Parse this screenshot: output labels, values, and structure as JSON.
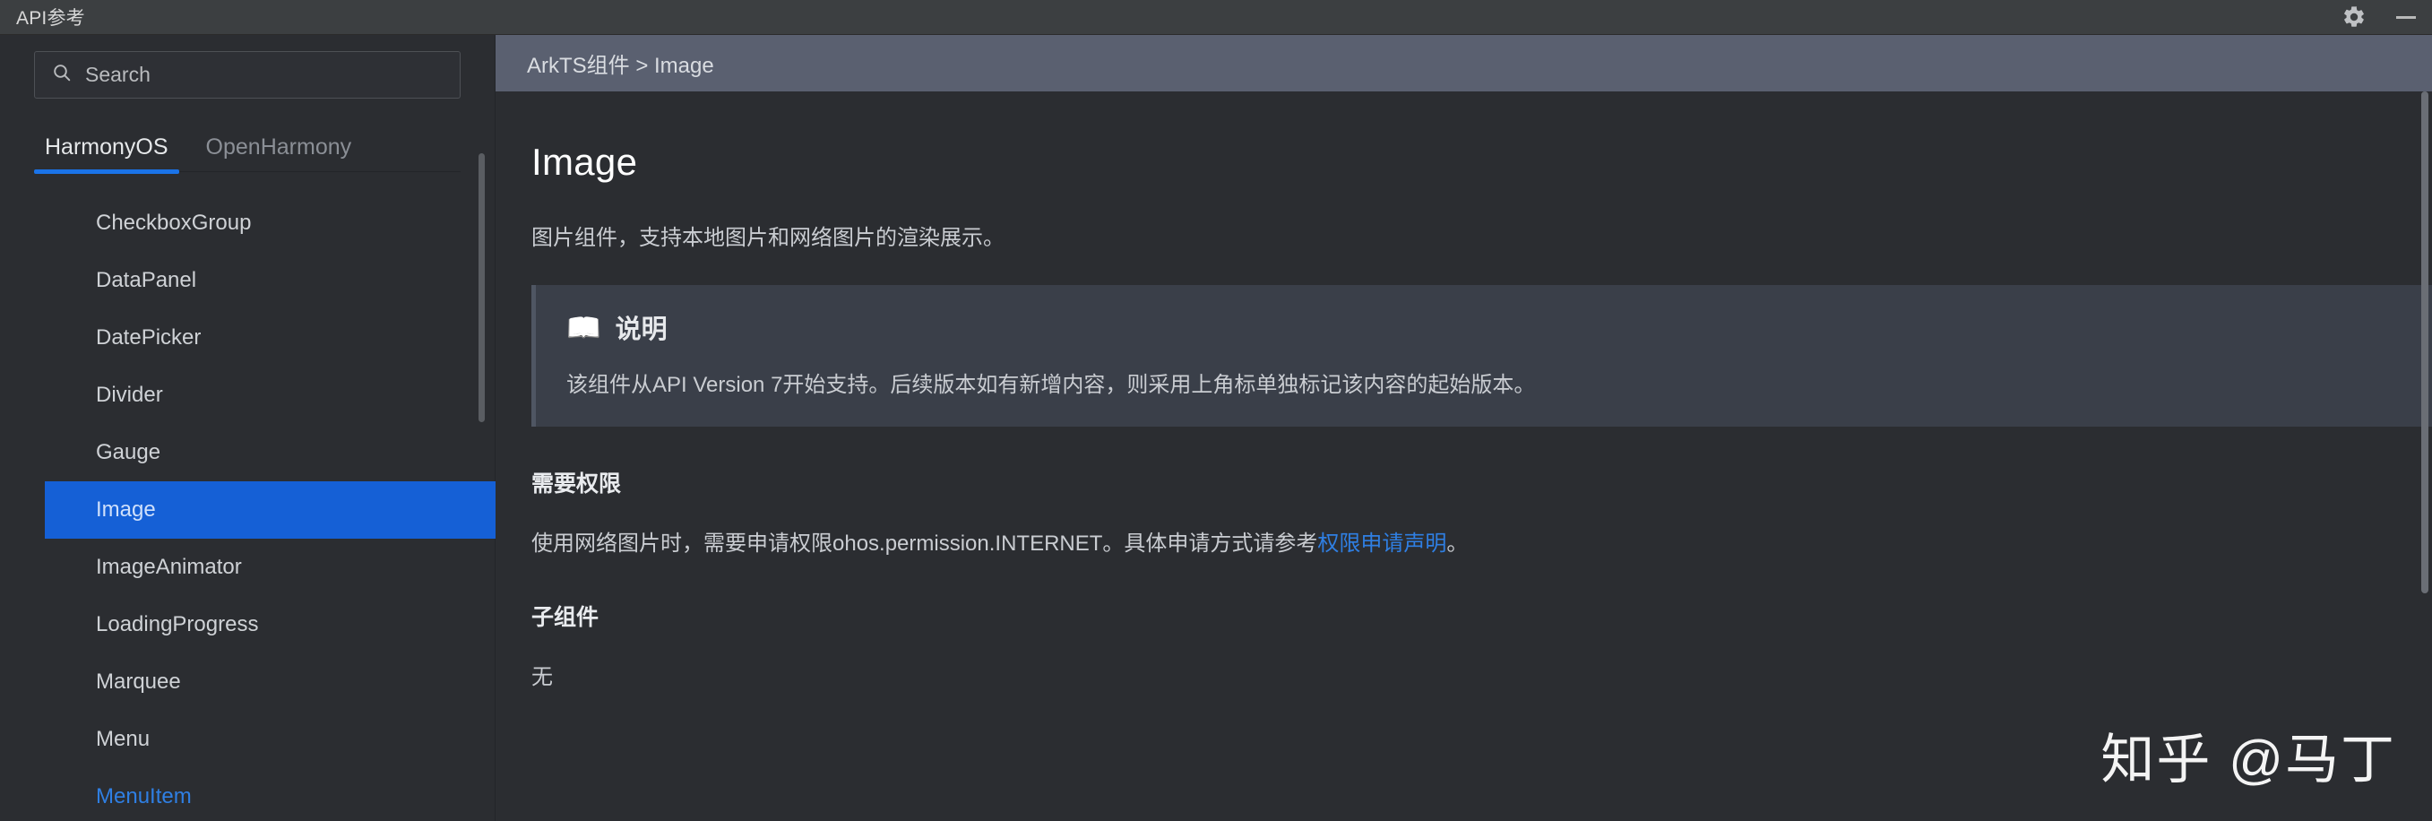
{
  "window": {
    "title": "API参考",
    "settings_icon": "gear-icon",
    "minimize_icon": "minimize-icon"
  },
  "sidebar": {
    "search": {
      "icon": "search-icon",
      "placeholder": "Search",
      "value": ""
    },
    "tabs": [
      {
        "label": "HarmonyOS",
        "active": true
      },
      {
        "label": "OpenHarmony",
        "active": false
      }
    ],
    "items": [
      {
        "label": "CheckboxGroup",
        "state": "normal"
      },
      {
        "label": "DataPanel",
        "state": "normal"
      },
      {
        "label": "DatePicker",
        "state": "normal"
      },
      {
        "label": "Divider",
        "state": "normal"
      },
      {
        "label": "Gauge",
        "state": "normal"
      },
      {
        "label": "Image",
        "state": "selected"
      },
      {
        "label": "ImageAnimator",
        "state": "normal"
      },
      {
        "label": "LoadingProgress",
        "state": "normal"
      },
      {
        "label": "Marquee",
        "state": "normal"
      },
      {
        "label": "Menu",
        "state": "normal"
      },
      {
        "label": "MenuItem",
        "state": "hovered"
      }
    ]
  },
  "content": {
    "breadcrumb": "ArkTS组件 > Image",
    "title": "Image",
    "intro": "图片组件，支持本地图片和网络图片的渲染展示。",
    "note": {
      "icon": "📖",
      "title": "说明",
      "body": "该组件从API Version 7开始支持。后续版本如有新增内容，则采用上角标单独标记该内容的起始版本。"
    },
    "sections": [
      {
        "heading": "需要权限",
        "text_before_link": "使用网络图片时，需要申请权限ohos.permission.INTERNET。具体申请方式请参考",
        "link": "权限申请声明",
        "text_after_link": "。"
      },
      {
        "heading": "子组件",
        "text": "无"
      }
    ]
  },
  "watermark": "知乎 @马丁",
  "colors": {
    "accent": "#1a73e8",
    "selected_row": "#1560d6",
    "link": "#2f7fe3",
    "titlebar": "#3c3f41",
    "background": "#2b2d31",
    "breadcrumb_bar": "#5a6070",
    "note_box": "#3a3f49"
  }
}
